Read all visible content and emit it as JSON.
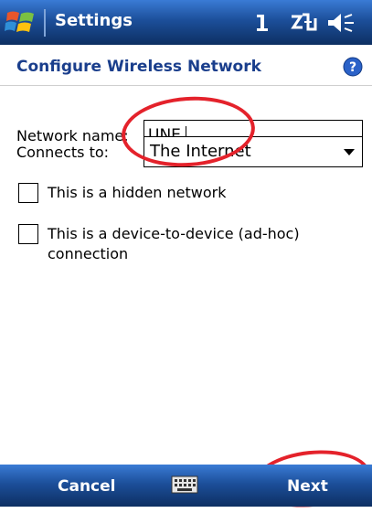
{
  "title_bar": {
    "title": "Settings",
    "start_icon": "windows-flag-icon",
    "status_icons": [
      "signal-icon",
      "connectivity-icon",
      "volume-icon"
    ]
  },
  "header": {
    "title": "Configure Wireless Network",
    "help_icon": "help-icon"
  },
  "form": {
    "network_name_label": "Network name:",
    "network_name_value": "UNE",
    "connects_to_label": "Connects to:",
    "connects_to_value": "The Internet",
    "hidden_network_label": "This is a hidden network",
    "hidden_network_checked": false,
    "adhoc_label_line1": "This is a device-to-device (ad-hoc)",
    "adhoc_label_line2": "connection",
    "adhoc_checked": false
  },
  "menu_bar": {
    "left_softkey": "Cancel",
    "right_softkey": "Next",
    "center_icon": "keyboard-icon"
  },
  "colors": {
    "bar_gradient_top": "#3a7bd5",
    "bar_gradient_bottom": "#0d2f62",
    "header_title": "#1a3e8c",
    "highlight": "#e4222b"
  }
}
